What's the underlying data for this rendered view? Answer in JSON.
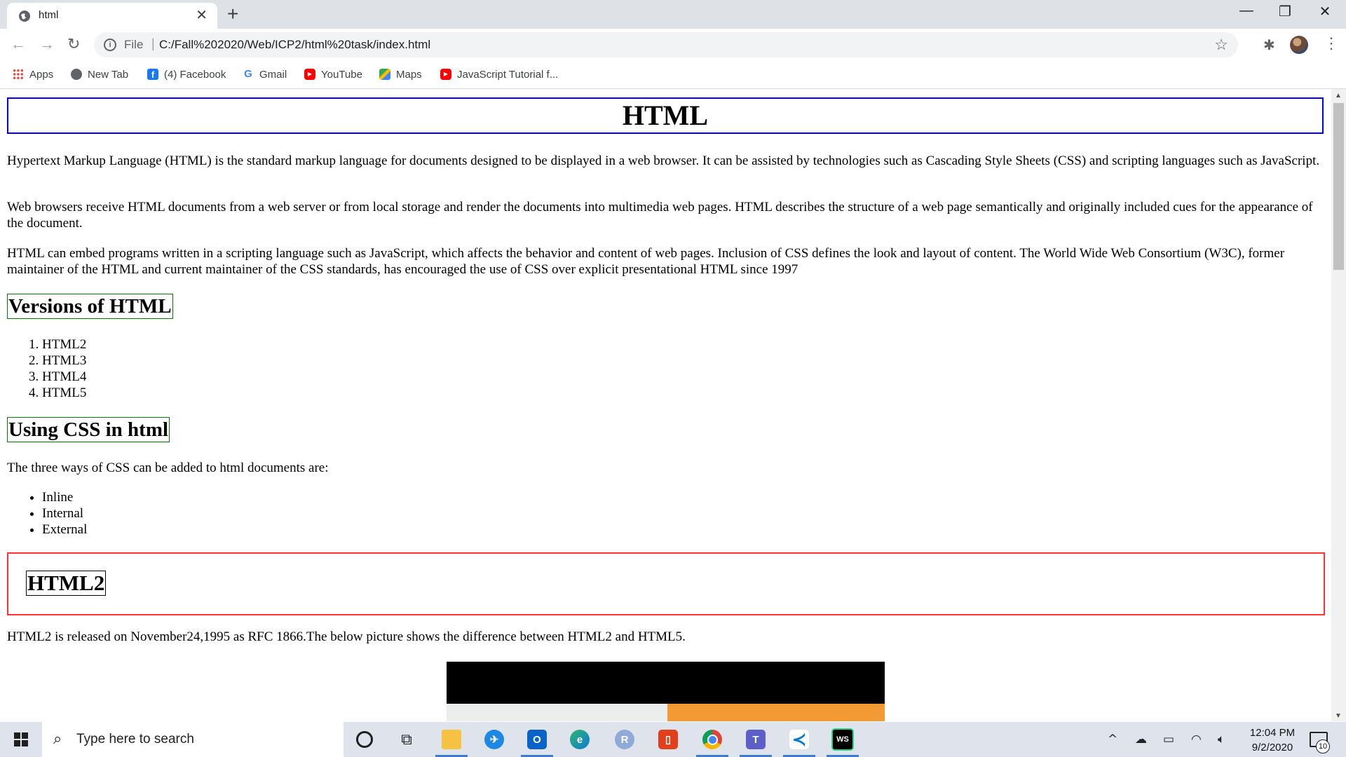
{
  "browser": {
    "tab_title": "html",
    "tab_close": "✕",
    "new_tab": "+",
    "window_controls": {
      "minimize": "—",
      "restore": "❐",
      "close": "✕"
    },
    "nav": {
      "back": "←",
      "forward": "→",
      "reload": "↻"
    },
    "address": {
      "scheme": "File",
      "separator": "|",
      "url": "C:/Fall%202020/Web/ICP2/html%20task/index.html"
    },
    "bookmarks": [
      {
        "label": "Apps",
        "icon": "apps-grid-icon",
        "color": "#4285f4"
      },
      {
        "label": "New Tab",
        "icon": "globe-icon",
        "color": "#5f6368"
      },
      {
        "label": "(4) Facebook",
        "icon": "facebook-icon",
        "color": "#1877f2"
      },
      {
        "label": "Gmail",
        "icon": "google-icon",
        "color": "#4285f4"
      },
      {
        "label": "YouTube",
        "icon": "youtube-icon",
        "color": "#ff0000"
      },
      {
        "label": "Maps",
        "icon": "maps-icon",
        "color": "#34a853"
      },
      {
        "label": "JavaScript Tutorial f...",
        "icon": "youtube-icon",
        "color": "#ff0000"
      }
    ]
  },
  "page": {
    "heading": "HTML",
    "paragraphs": [
      "Hypertext Markup Language (HTML) is the standard markup language for documents designed to be displayed in a web browser. It can be assisted by technologies such as Cascading Style Sheets (CSS) and scripting languages such as JavaScript.",
      "Web browsers receive HTML documents from a web server or from local storage and render the documents into multimedia web pages. HTML describes the structure of a web page semantically and originally included cues for the appearance of the document.",
      "HTML can embed programs written in a scripting language such as JavaScript, which affects the behavior and content of web pages. Inclusion of CSS defines the look and layout of content. The World Wide Web Consortium (W3C), former maintainer of the HTML and current maintainer of the CSS standards, has encouraged the use of CSS over explicit presentational HTML since 1997"
    ],
    "versions_heading": "Versions of HTML",
    "versions": [
      "HTML2",
      "HTML3",
      "HTML4",
      "HTML5"
    ],
    "css_heading": "Using CSS in html",
    "css_intro": "The three ways of CSS can be added to html documents are:",
    "css_ways": [
      "Inline",
      "Internal",
      "External"
    ],
    "html2_heading": "HTML2",
    "html2_text": "HTML2 is released on November24,1995 as RFC 1866.The below picture shows the difference between HTML2 and HTML5."
  },
  "taskbar": {
    "search_placeholder": "Type here to search",
    "time": "12:04 PM",
    "date": "9/2/2020",
    "notification_count": "10"
  }
}
